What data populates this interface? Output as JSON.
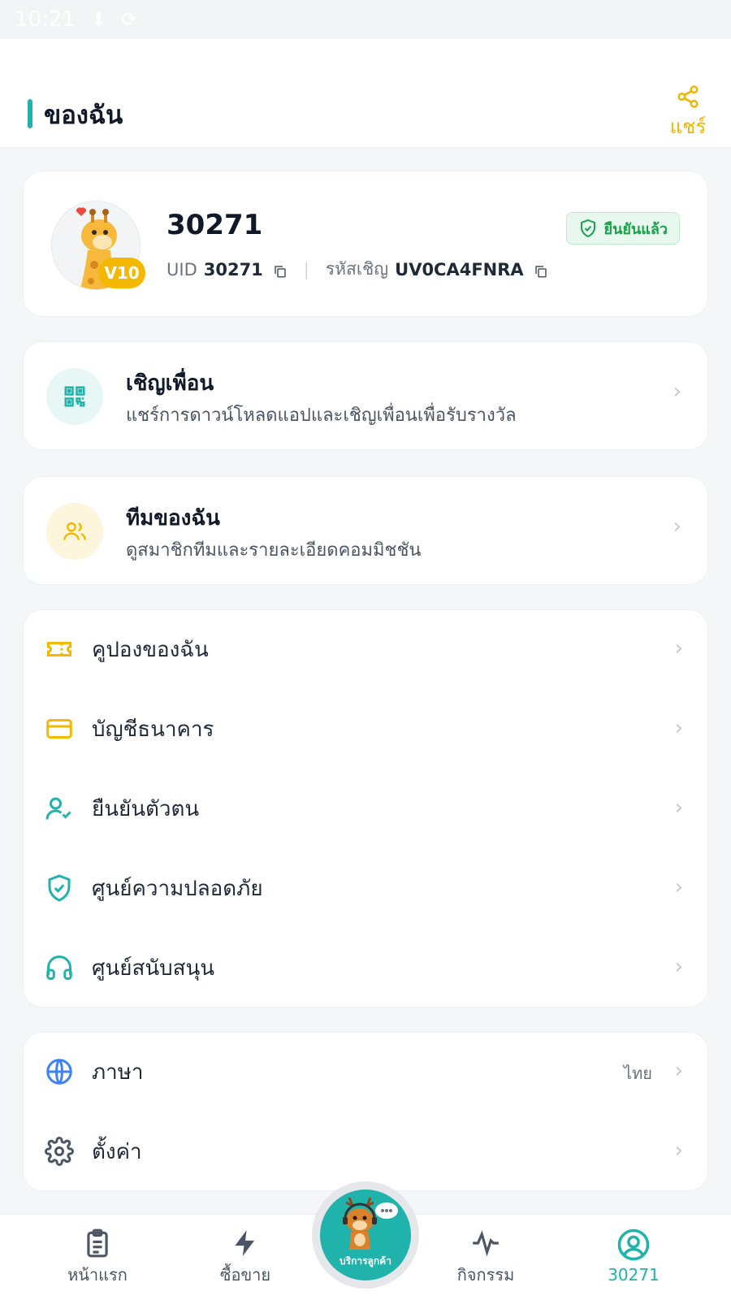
{
  "status_bar": {
    "time": "10:21"
  },
  "header": {
    "title": "ของฉัน",
    "share_label": "แชร์"
  },
  "profile": {
    "name": "30271",
    "vip_level": "V10",
    "uid_label": "UID",
    "uid_value": "30271",
    "invite_code_label": "รหัสเชิญ",
    "invite_code_value": "UV0CA4FNRA",
    "verified_label": "ยืนยันแล้ว"
  },
  "invite_card": {
    "title": "เชิญเพื่อน",
    "subtitle": "แชร์การดาวน์โหลดแอปและเชิญเพื่อนเพื่อรับรางวัล"
  },
  "team_card": {
    "title": "ทีมของฉัน",
    "subtitle": "ดูสมาชิกทีมและรายละเอียดคอมมิชชัน"
  },
  "menu": [
    {
      "label": "คูปองของฉัน",
      "icon": "ticket-icon"
    },
    {
      "label": "บัญชีธนาคาร",
      "icon": "credit-card-icon"
    },
    {
      "label": "ยืนยันตัวตน",
      "icon": "user-check-icon"
    },
    {
      "label": "ศูนย์ความปลอดภัย",
      "icon": "shield-check-icon"
    },
    {
      "label": "ศูนย์สนับสนุน",
      "icon": "headphones-icon"
    }
  ],
  "settings": [
    {
      "label": "ภาษา",
      "value": "ไทย",
      "icon": "globe-icon"
    },
    {
      "label": "ตั้งค่า",
      "icon": "gear-icon"
    }
  ],
  "bottom_nav": {
    "home": "หน้าแรก",
    "trade": "ซื้อขาย",
    "customer_service": "บริการลูกค้า",
    "activity": "กิจกรรม",
    "profile": "30271"
  },
  "colors": {
    "accent": "#1fb3ab",
    "gold": "#f5b800",
    "verified": "#16a34a"
  }
}
